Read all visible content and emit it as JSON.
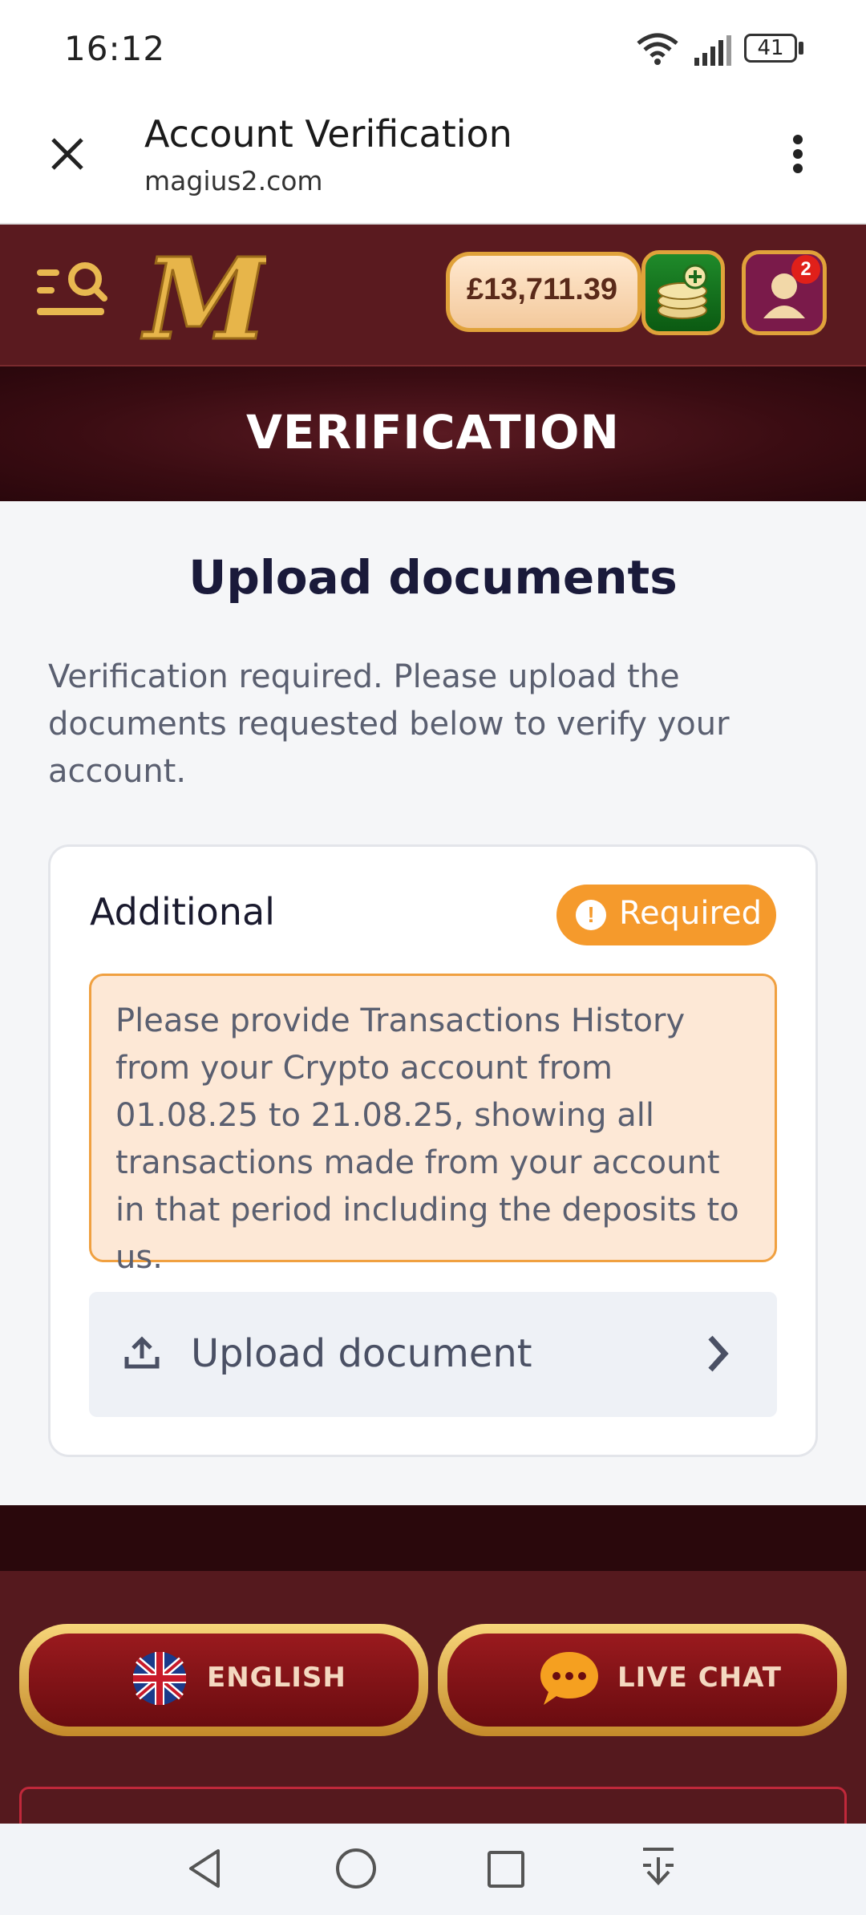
{
  "status_bar": {
    "time": "16:12",
    "battery": "41"
  },
  "browser": {
    "title": "Account Verification",
    "url": "magius2.com"
  },
  "header": {
    "balance": "£13,711.39",
    "notifications": "2"
  },
  "banner": {
    "title": "VERIFICATION"
  },
  "main": {
    "heading": "Upload documents",
    "intro": "Verification required. Please upload the documents requested below to verify your account.",
    "card": {
      "title": "Additional",
      "status": "Required",
      "note": "Please provide Transactions History from your Crypto account from 01.08.25 to 21.08.25, showing all transactions made from your account in that period including the deposits to us.",
      "upload_label": "Upload document"
    }
  },
  "footer": {
    "language_label": "ENGLISH",
    "chat_label": "LIVE CHAT"
  },
  "colors": {
    "header_bg": "#5a1a1f",
    "accent_gold": "#e0a23a",
    "required_orange": "#f59a2c",
    "note_bg": "#fde8d6"
  }
}
